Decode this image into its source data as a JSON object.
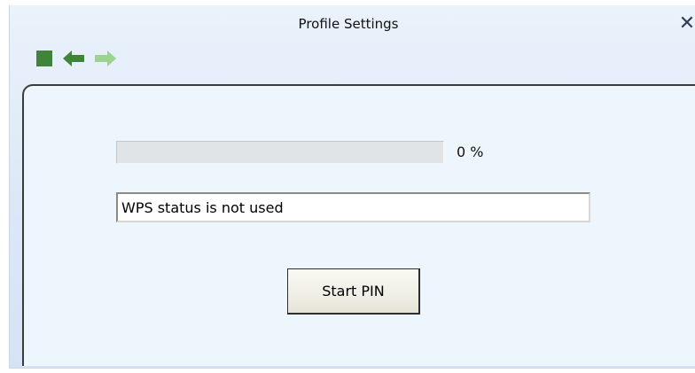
{
  "window": {
    "title": "Profile Settings",
    "close_glyph": "✕"
  },
  "toolbar": {
    "buttons": [
      {
        "icon": "stop-square-icon",
        "color": "#40843c",
        "enabled": true
      },
      {
        "icon": "arrow-left-icon",
        "color": "#40843c",
        "enabled": true
      },
      {
        "icon": "arrow-right-icon",
        "color": "#9bd38f",
        "enabled": false
      }
    ]
  },
  "wps": {
    "progress": 0,
    "progress_label": "0 %",
    "status_value": "WPS status is not used",
    "start_button_label": "Start PIN"
  },
  "colors": {
    "accent_green": "#40843c",
    "disabled_green": "#9bd38f",
    "panel_background": "#eef6fd"
  }
}
